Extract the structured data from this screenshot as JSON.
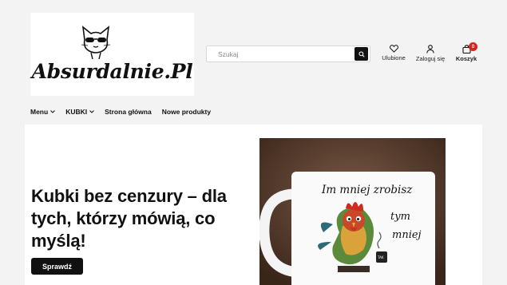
{
  "header": {
    "logo_text": "Absurdalnie.Pl",
    "search": {
      "placeholder": "Szukaj"
    },
    "favorites_label": "Ulubione",
    "login_label": "Zaloguj się",
    "cart_label": "Koszyk",
    "cart_count": "0"
  },
  "nav": {
    "items": [
      {
        "label": "Menu",
        "has_dropdown": true
      },
      {
        "label": "KUBKI",
        "has_dropdown": true
      },
      {
        "label": "Strona główna",
        "has_dropdown": false
      },
      {
        "label": "Nowe produkty",
        "has_dropdown": false
      }
    ]
  },
  "hero": {
    "title": "Kubki bez cenzury – dla tych, którzy mówią, co myślą!",
    "cta_label": "Sprawdź",
    "mug_text": [
      "Im mniej zrobisz",
      "tym",
      "mniej"
    ]
  },
  "colors": {
    "accent": "#111111",
    "badge": "#d9221c",
    "background": "#f3f3f3"
  }
}
